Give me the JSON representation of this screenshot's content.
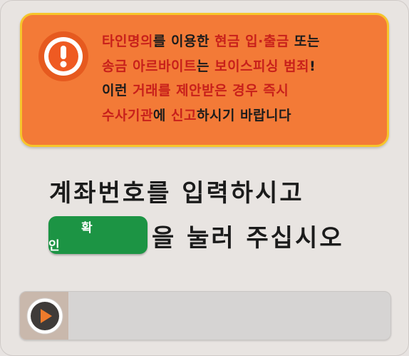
{
  "warning": {
    "icon": "exclamation-icon",
    "lines": [
      [
        {
          "text": "타인명의",
          "hl": true
        },
        {
          "text": "를 이용한 ",
          "hl": false
        },
        {
          "text": "현금 입·출금",
          "hl": true
        },
        {
          "text": " 또는",
          "hl": false
        }
      ],
      [
        {
          "text": "송금 아르바이트",
          "hl": true
        },
        {
          "text": "는 ",
          "hl": false
        },
        {
          "text": "보이스피싱 범죄",
          "hl": true
        },
        {
          "text": "!",
          "hl": false
        }
      ],
      [
        {
          "text": "이런 ",
          "hl": false
        },
        {
          "text": "거래를 제안받은 경우 즉시",
          "hl": true
        }
      ],
      [
        {
          "text": "수사기관",
          "hl": true
        },
        {
          "text": "에 ",
          "hl": false
        },
        {
          "text": "신고",
          "hl": true
        },
        {
          "text": "하시기 바랍니다",
          "hl": false
        }
      ]
    ]
  },
  "instruction": {
    "line1": "계좌번호를 입력하시고",
    "line2_suffix": "을 눌러 주십시오",
    "confirm_label": "확인"
  },
  "player": {
    "icon": "play-icon",
    "progress": 0.13
  },
  "colors": {
    "warning_bg": "#f37a37",
    "warning_border": "#f6c52b",
    "highlight_text": "#c8201b",
    "confirm_bg": "#1c9444"
  }
}
